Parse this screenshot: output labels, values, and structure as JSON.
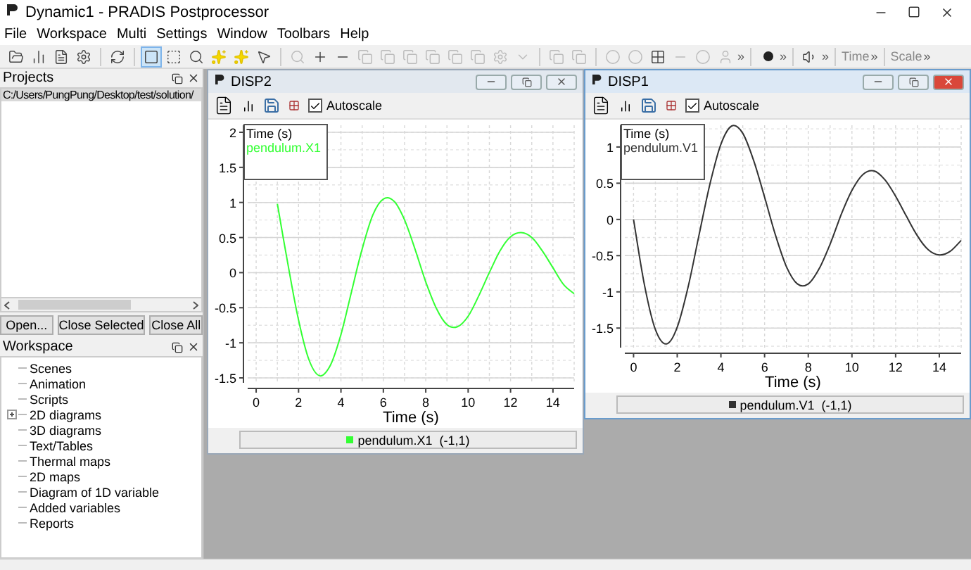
{
  "window": {
    "title": "Dynamic1 - PRADIS Postprocessor"
  },
  "menu": [
    {
      "label": "File"
    },
    {
      "label": "Workspace"
    },
    {
      "label": "Multi"
    },
    {
      "label": "Settings"
    },
    {
      "label": "Window"
    },
    {
      "label": "Toolbars"
    },
    {
      "label": "Help"
    }
  ],
  "toolbar": [
    {
      "kind": "folder",
      "disabled": false,
      "selected": false
    },
    {
      "kind": "chart",
      "disabled": false,
      "selected": false
    },
    {
      "kind": "document",
      "disabled": false,
      "selected": false
    },
    {
      "kind": "gear",
      "disabled": false,
      "selected": false
    },
    {
      "kind": "sep"
    },
    {
      "kind": "refresh",
      "disabled": false,
      "selected": false
    },
    {
      "kind": "sep"
    },
    {
      "kind": "square",
      "disabled": false,
      "selected": true
    },
    {
      "kind": "frame",
      "disabled": false,
      "selected": false
    },
    {
      "kind": "search",
      "disabled": false,
      "selected": false
    },
    {
      "kind": "star",
      "disabled": false,
      "selected": false
    },
    {
      "kind": "star",
      "disabled": false,
      "selected": false
    },
    {
      "kind": "pointer",
      "disabled": false,
      "selected": false
    },
    {
      "kind": "sep"
    },
    {
      "kind": "search",
      "disabled": true,
      "selected": false
    },
    {
      "kind": "plus",
      "disabled": false,
      "selected": false
    },
    {
      "kind": "minus",
      "disabled": false,
      "selected": false
    },
    {
      "kind": "copy",
      "disabled": true,
      "selected": false
    },
    {
      "kind": "copy",
      "disabled": true,
      "selected": false
    },
    {
      "kind": "copy",
      "disabled": true,
      "selected": false
    },
    {
      "kind": "copy",
      "disabled": true,
      "selected": false
    },
    {
      "kind": "copy",
      "disabled": true,
      "selected": false
    },
    {
      "kind": "copy",
      "disabled": true,
      "selected": false
    },
    {
      "kind": "gear",
      "disabled": true,
      "selected": false
    },
    {
      "kind": "caret",
      "disabled": true,
      "selected": false
    },
    {
      "kind": "sep"
    },
    {
      "kind": "copy",
      "disabled": true,
      "selected": false
    },
    {
      "kind": "copy",
      "disabled": true,
      "selected": false
    },
    {
      "kind": "sep"
    },
    {
      "kind": "circle",
      "disabled": true,
      "selected": false
    },
    {
      "kind": "circle",
      "disabled": true,
      "selected": false
    },
    {
      "kind": "grid",
      "disabled": false,
      "selected": false
    },
    {
      "kind": "minus",
      "disabled": true,
      "selected": false
    },
    {
      "kind": "circle",
      "disabled": true,
      "selected": false
    },
    {
      "kind": "user",
      "disabled": true,
      "selected": false
    },
    {
      "kind": "more",
      "text": "»"
    },
    {
      "kind": "sep"
    },
    {
      "kind": "dot",
      "disabled": false,
      "selected": false
    },
    {
      "kind": "more",
      "text": "»"
    },
    {
      "kind": "sep"
    },
    {
      "kind": "speaker",
      "disabled": false,
      "selected": false
    },
    {
      "kind": "more",
      "text": "»"
    },
    {
      "kind": "sep"
    },
    {
      "kind": "label",
      "text": "Time"
    },
    {
      "kind": "more",
      "text": "»"
    },
    {
      "kind": "sep"
    },
    {
      "kind": "label",
      "text": "Scale"
    },
    {
      "kind": "more",
      "text": "»"
    }
  ],
  "projects": {
    "title": "Projects",
    "items": [
      {
        "label": "C:/Users/PungPung/Desktop/test/solution/",
        "selected": true
      }
    ],
    "buttons": [
      "Open...",
      "Close Selected",
      "Close All"
    ]
  },
  "workspace": {
    "title": "Workspace",
    "items": [
      {
        "label": "Scenes"
      },
      {
        "label": "Animation"
      },
      {
        "label": "Scripts"
      },
      {
        "label": "2D diagrams",
        "expanded": false
      },
      {
        "label": "3D diagrams"
      },
      {
        "label": "Text/Tables"
      },
      {
        "label": "Thermal maps"
      },
      {
        "label": "2D maps"
      },
      {
        "label": "Diagram of 1D variable"
      },
      {
        "label": "Added variables"
      },
      {
        "label": "Reports"
      }
    ]
  },
  "subwindows": [
    {
      "title": "DISP2",
      "active": false,
      "autoscale": {
        "label": "Autoscale",
        "checked": true
      },
      "info_box": {
        "title": "Time (s)"
      },
      "legend": {
        "range": "(-1,1)"
      },
      "chart_data": {
        "type": "line",
        "grid": true,
        "xlabel": "Time (s)",
        "x": [
          1,
          1.5,
          2,
          2.5,
          3,
          3.5,
          4,
          4.5,
          5,
          5.5,
          6,
          6.5,
          7,
          7.5,
          8,
          8.5,
          9,
          9.5,
          10,
          10.5,
          11,
          11.5,
          12,
          12.5,
          13,
          13.5,
          14,
          14.5,
          15
        ],
        "xlim": [
          -0.4,
          15
        ],
        "ylim": [
          -1.57,
          2.1
        ],
        "xticks": [
          0,
          2,
          4,
          6,
          8,
          10,
          12,
          14
        ],
        "yticks": [
          -1.5,
          -1,
          -0.5,
          0,
          0.5,
          1,
          1.5,
          2
        ],
        "series": [
          {
            "name": "pendulum.X1",
            "color": "#33ff33",
            "values": [
              0.98,
              0.12,
              -0.68,
              -1.25,
              -1.47,
              -1.32,
              -0.88,
              -0.27,
              0.34,
              0.82,
              1.05,
              1.02,
              0.75,
              0.33,
              -0.13,
              -0.51,
              -0.74,
              -0.77,
              -0.62,
              -0.33,
              0.0,
              0.31,
              0.51,
              0.57,
              0.5,
              0.31,
              0.07,
              -0.17,
              -0.3
            ]
          }
        ]
      }
    },
    {
      "title": "DISP1",
      "active": true,
      "autoscale": {
        "label": "Autoscale",
        "checked": true
      },
      "info_box": {
        "title": "Time (s)"
      },
      "legend": {
        "range": "(-1,1)"
      },
      "chart_data": {
        "type": "line",
        "grid": true,
        "xlabel": "Time (s)",
        "x": [
          0,
          0.5,
          1,
          1.5,
          2,
          2.5,
          3,
          3.5,
          4,
          4.5,
          5,
          5.5,
          6,
          6.5,
          7,
          7.5,
          8,
          8.5,
          9,
          9.5,
          10,
          10.5,
          11,
          11.5,
          12,
          12.5,
          13,
          13.5,
          14,
          14.5,
          15
        ],
        "xlim": [
          -0.4,
          15
        ],
        "ylim": [
          -1.77,
          1.3
        ],
        "xticks": [
          0,
          2,
          4,
          6,
          8,
          10,
          12,
          14
        ],
        "yticks": [
          -1.5,
          -1,
          -0.5,
          0,
          0.5,
          1
        ],
        "series": [
          {
            "name": "pendulum.V1",
            "color": "#333333",
            "values": [
              0,
              -0.91,
              -1.52,
              -1.72,
              -1.49,
              -0.93,
              -0.21,
              0.49,
              1.04,
              1.29,
              1.19,
              0.81,
              0.31,
              -0.22,
              -0.65,
              -0.89,
              -0.89,
              -0.68,
              -0.34,
              0.06,
              0.4,
              0.62,
              0.67,
              0.55,
              0.32,
              0.04,
              -0.23,
              -0.42,
              -0.49,
              -0.44,
              -0.29
            ]
          }
        ]
      }
    }
  ]
}
